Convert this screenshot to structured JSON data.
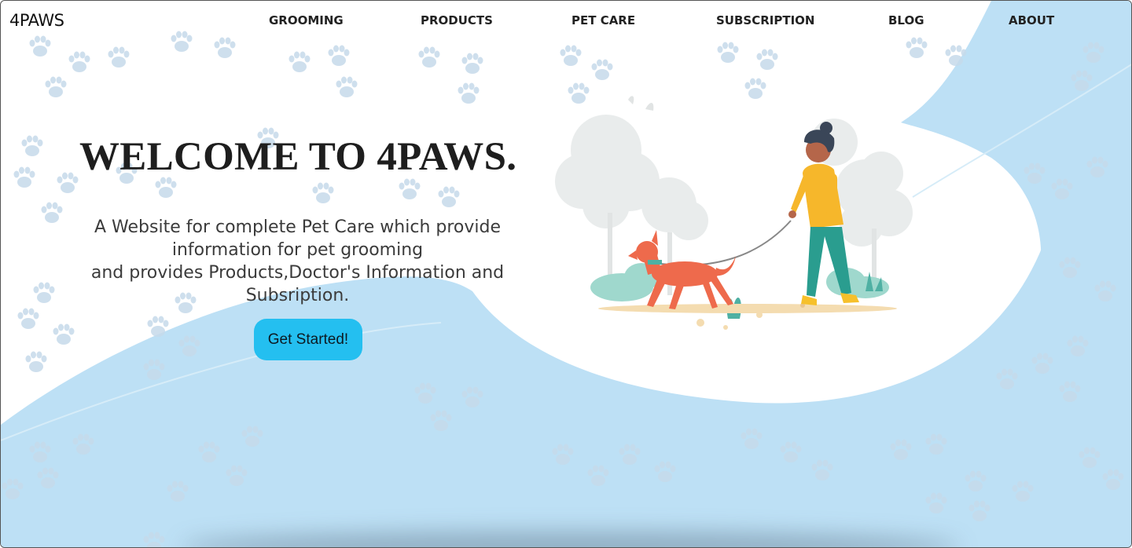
{
  "brand": {
    "logo": "4PAWS"
  },
  "nav": {
    "items": [
      {
        "label": "GROOMING"
      },
      {
        "label": "PRODUCTS"
      },
      {
        "label": "PET CARE"
      },
      {
        "label": "SUBSCRIPTION"
      },
      {
        "label": "BLOG"
      },
      {
        "label": "ABOUT"
      }
    ]
  },
  "hero": {
    "title": "WELCOME TO 4PAWS.",
    "subtitle_lines": [
      "A Website for complete Pet Care which provide",
      "information for pet grooming",
      "and provides Products,Doctor's Information and",
      "Subsription."
    ],
    "cta_label": "Get Started!"
  },
  "colors": {
    "blob": "#bde0f5",
    "paw": "#c6daea",
    "cta": "#24bff0",
    "title": "#1e1e1e"
  },
  "icons": {
    "pattern": "paw-print-icon",
    "illustration": "person-walking-dog-illustration"
  }
}
